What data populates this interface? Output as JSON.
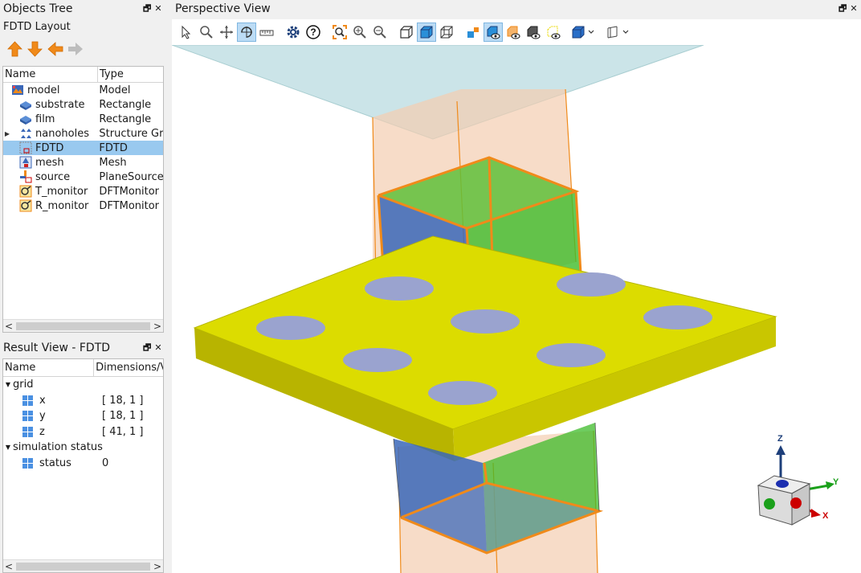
{
  "objects_tree": {
    "title": "Objects Tree",
    "layout_label": "FDTD Layout",
    "columns": [
      "Name",
      "Type"
    ],
    "rows": [
      {
        "name": "model",
        "type": "Model",
        "icon": "model-icon"
      },
      {
        "name": "substrate",
        "type": "Rectangle",
        "icon": "rectangle-icon"
      },
      {
        "name": "film",
        "type": "Rectangle",
        "icon": "rectangle-icon"
      },
      {
        "name": "nanoholes",
        "type": "Structure Gr...",
        "icon": "structure-group-icon"
      },
      {
        "name": "FDTD",
        "type": "FDTD",
        "icon": "fdtd-icon"
      },
      {
        "name": "mesh",
        "type": "Mesh",
        "icon": "mesh-icon"
      },
      {
        "name": "source",
        "type": "PlaneSource",
        "icon": "plane-source-icon"
      },
      {
        "name": "T_monitor",
        "type": "DFTMonitor",
        "icon": "dft-monitor-icon"
      },
      {
        "name": "R_monitor",
        "type": "DFTMonitor",
        "icon": "dft-monitor-icon"
      }
    ]
  },
  "result_view": {
    "title": "Result View - FDTD",
    "columns": [
      "Name",
      "Dimensions/V"
    ],
    "groups": [
      {
        "name": "grid",
        "items": [
          {
            "name": "x",
            "value": "[ 18, 1 ]"
          },
          {
            "name": "y",
            "value": "[ 18, 1 ]"
          },
          {
            "name": "z",
            "value": "[ 41, 1 ]"
          }
        ]
      },
      {
        "name": "simulation status",
        "items": [
          {
            "name": "status",
            "value": "0"
          }
        ]
      }
    ]
  },
  "perspective_view": {
    "title": "Perspective View",
    "axis_labels": {
      "z": "Z",
      "y": "Y",
      "x": "X"
    }
  },
  "dock_buttons": {
    "float": "🗗",
    "close": "✕"
  },
  "colors": {
    "selection": "#99c9ef",
    "film": "#d9d900",
    "holes": "#9aa3cf",
    "fdtd_orange": "#f08a1a",
    "source_blue": "#3a67b8",
    "monitor_green": "#3dbb2a",
    "toolbar_active": "#bcdcf5"
  }
}
